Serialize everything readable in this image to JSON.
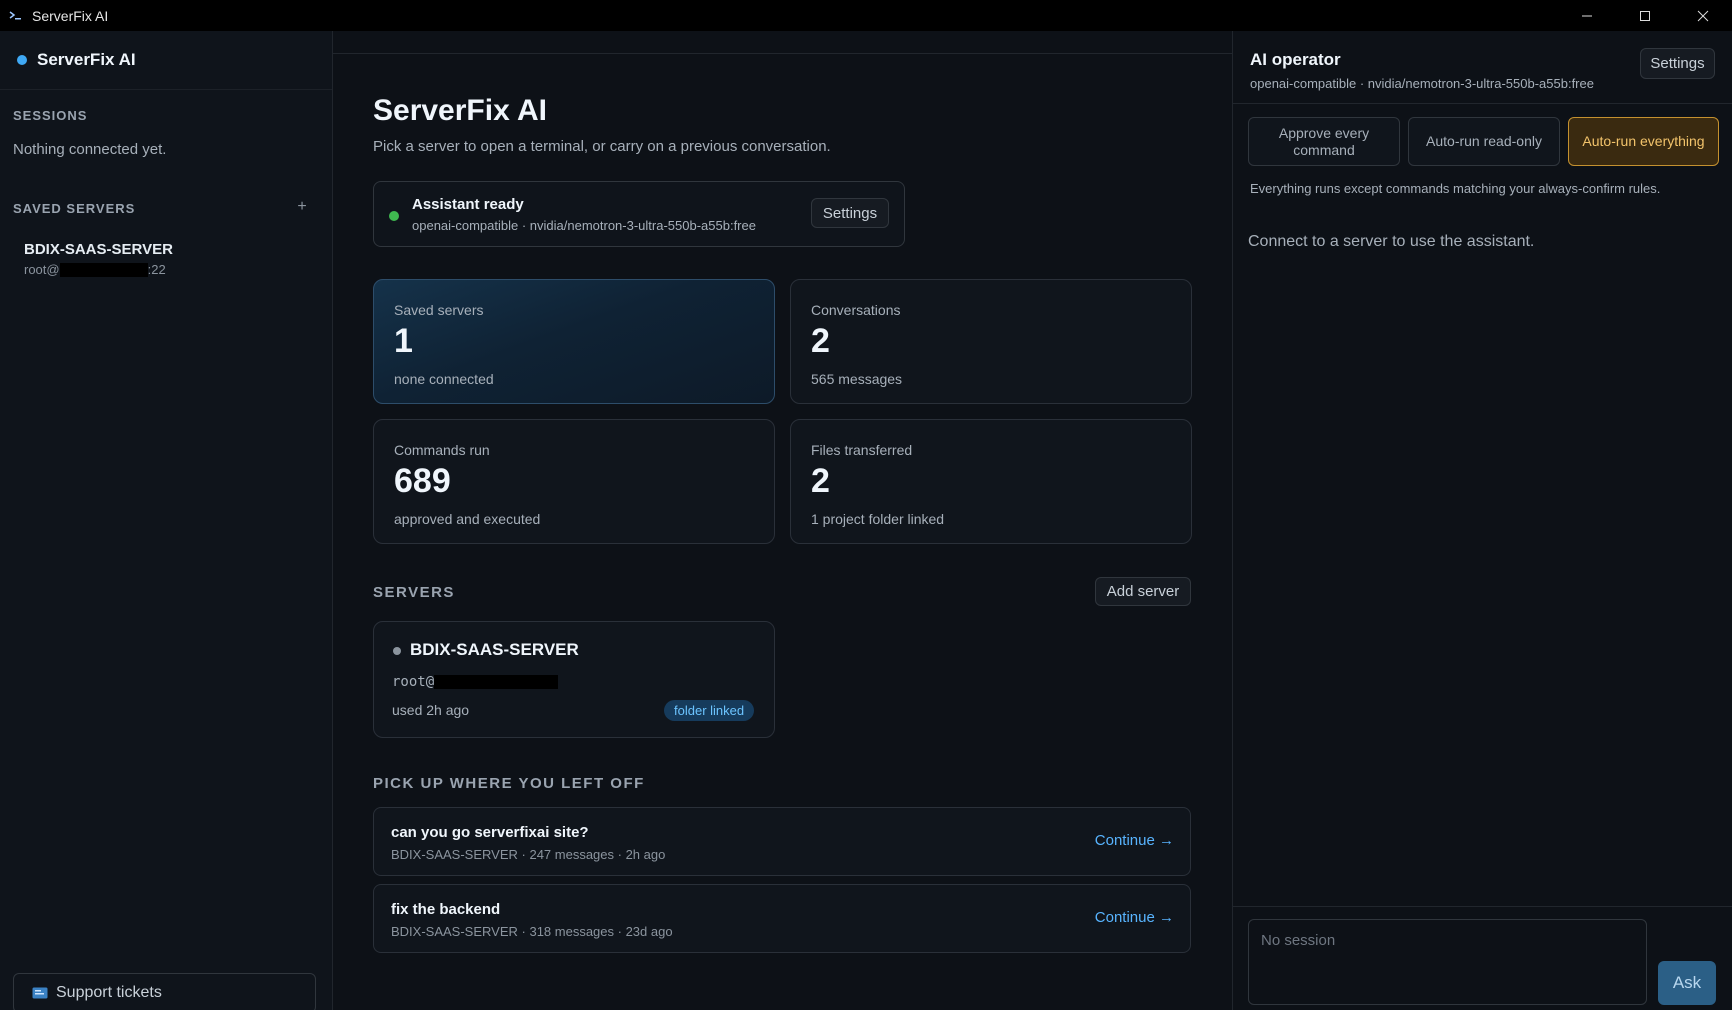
{
  "window": {
    "title": "ServerFix AI"
  },
  "sidebar": {
    "brand": "ServerFix AI",
    "sessions_title": "SESSIONS",
    "sessions_empty": "Nothing connected yet.",
    "saved_title": "SAVED SERVERS",
    "add_symbol": "+",
    "saved_servers": [
      {
        "name": "BDIX-SAAS-SERVER",
        "host_prefix": "root@",
        "host_suffix": ":22"
      }
    ],
    "support_label": "Support tickets"
  },
  "main": {
    "title": "ServerFix AI",
    "subtitle": "Pick a server to open a terminal, or carry on a previous conversation.",
    "status": {
      "title": "Assistant ready",
      "subtitle": "openai-compatible · nvidia/nemotron-3-ultra-550b-a55b:free",
      "settings_label": "Settings"
    },
    "stats": [
      {
        "label": "Saved servers",
        "value": "1",
        "sub": "none connected"
      },
      {
        "label": "Conversations",
        "value": "2",
        "sub": "565 messages"
      },
      {
        "label": "Commands run",
        "value": "689",
        "sub": "approved and executed"
      },
      {
        "label": "Files transferred",
        "value": "2",
        "sub": "1 project folder linked"
      }
    ],
    "servers_title": "SERVERS",
    "add_server_label": "Add server",
    "server_card": {
      "name": "BDIX-SAAS-SERVER",
      "host_prefix": "root@",
      "used": "used 2h ago",
      "badge": "folder linked"
    },
    "pickup_title": "PICK UP WHERE YOU LEFT OFF",
    "conversations": [
      {
        "title": "can you go serverfixai site?",
        "meta": "BDIX-SAAS-SERVER · 247 messages · 2h ago",
        "action": "Continue →"
      },
      {
        "title": "fix the backend",
        "meta": "BDIX-SAAS-SERVER · 318 messages · 23d ago",
        "action": "Continue →"
      }
    ]
  },
  "operator": {
    "title": "AI operator",
    "subtitle": "openai-compatible · nvidia/nemotron-3-ultra-550b-a55b:free",
    "settings_label": "Settings",
    "modes": [
      {
        "label": "Approve every command",
        "active": false
      },
      {
        "label": "Auto-run read-only",
        "active": false
      },
      {
        "label": "Auto-run everything",
        "active": true
      }
    ],
    "hint": "Everything runs except commands matching your always-confirm rules.",
    "empty": "Connect to a server to use the assistant.",
    "input_placeholder": "No session",
    "ask_label": "Ask"
  },
  "colors": {
    "accent": "#3fa9f5",
    "ready": "#3fb950",
    "active_mode": "#c4912f",
    "link": "#58b4ff"
  }
}
